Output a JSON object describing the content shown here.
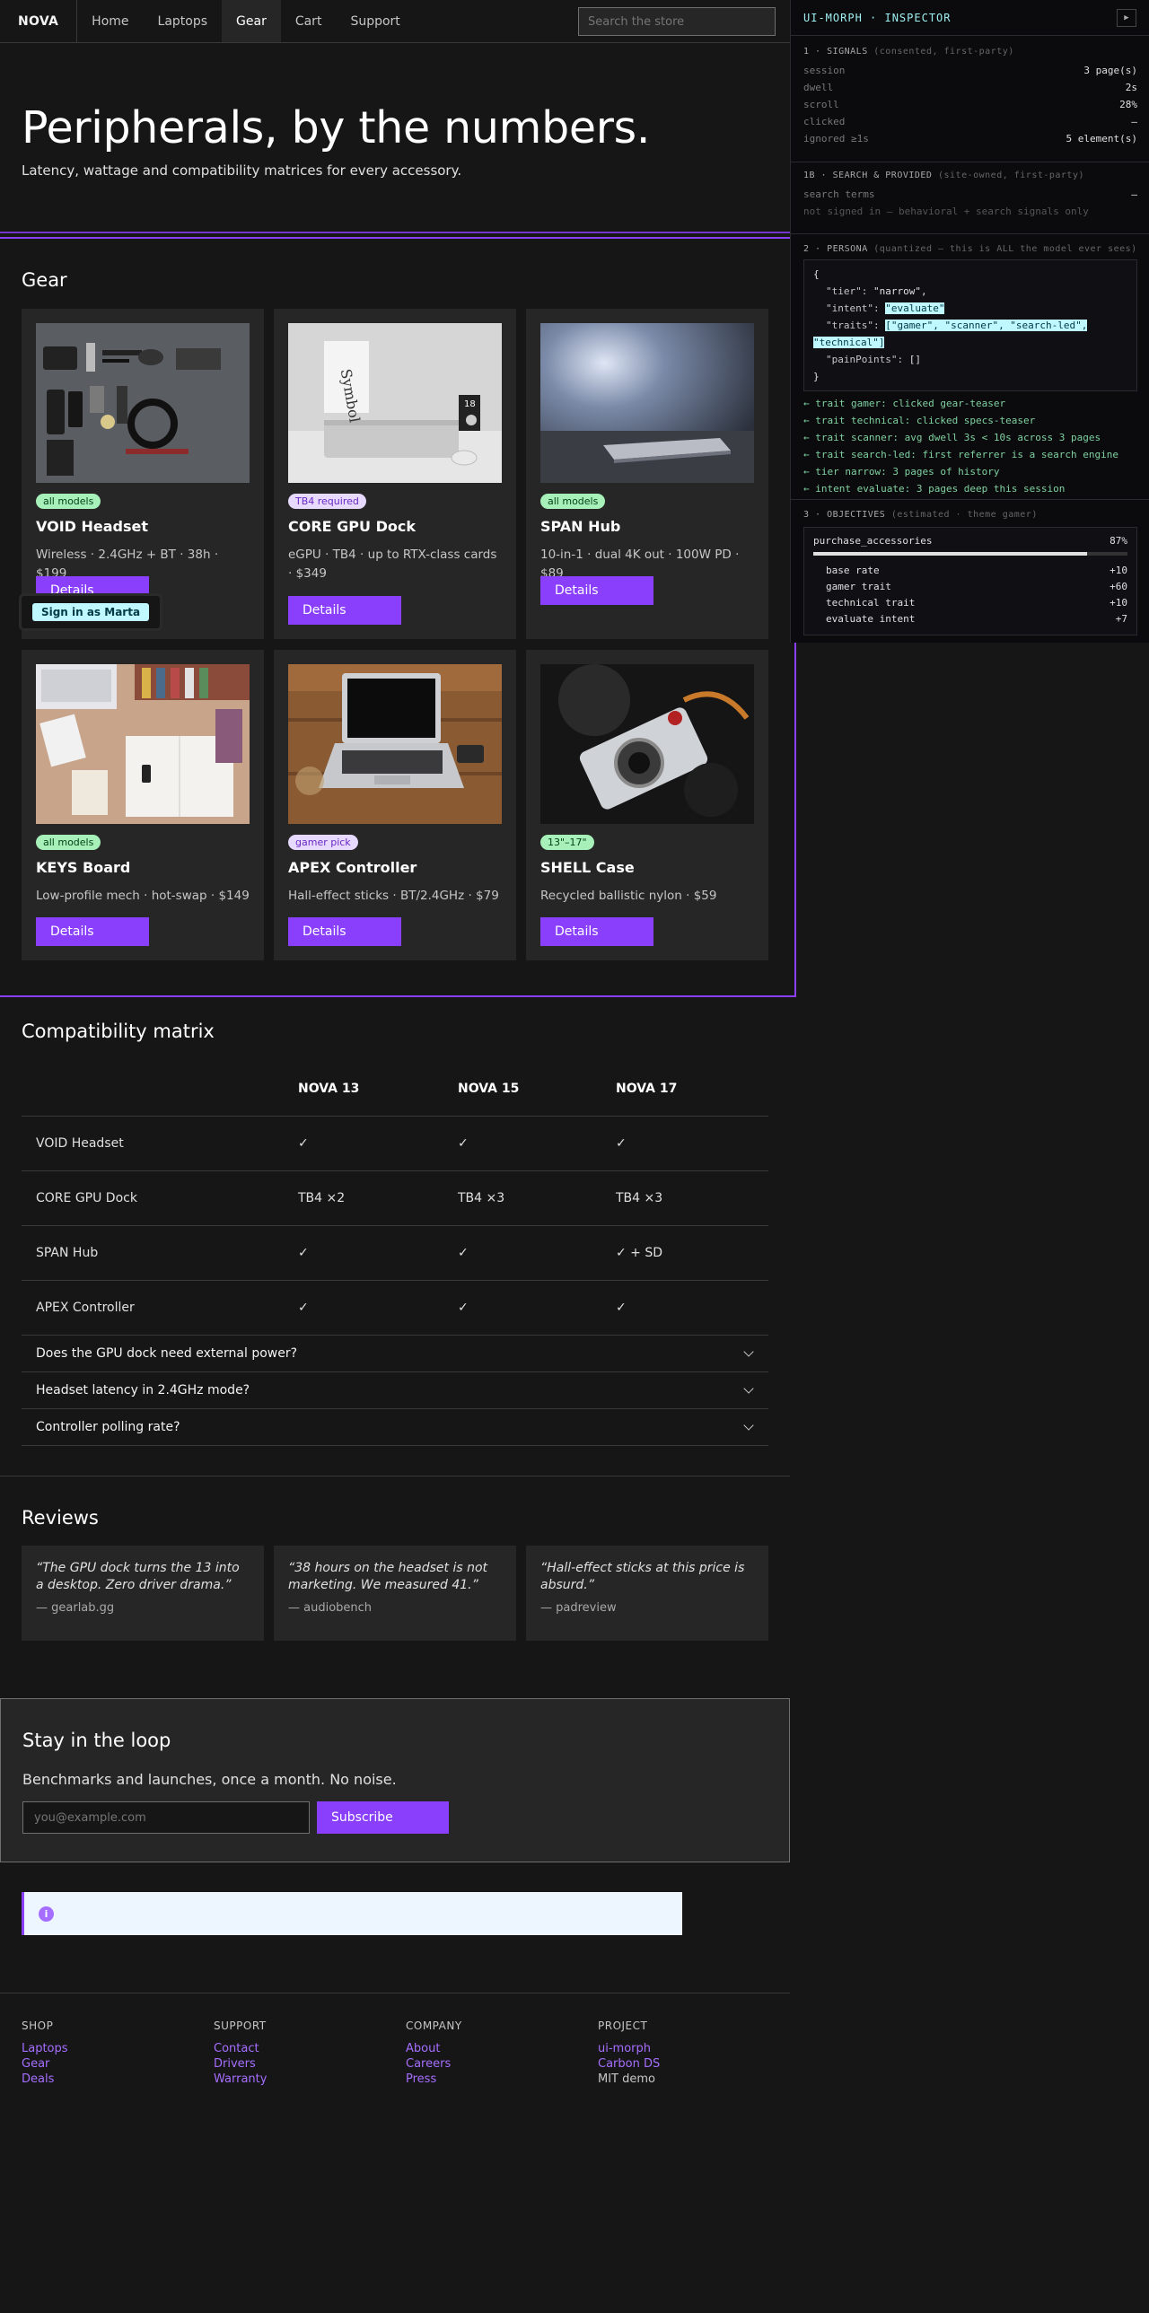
{
  "nav": {
    "brand": "NOVA",
    "links": [
      "Home",
      "Laptops",
      "Gear",
      "Cart",
      "Support"
    ],
    "active": "Gear",
    "search_placeholder": "Search the store"
  },
  "hero": {
    "title": "Peripherals, by the numbers.",
    "subtitle": "Latency, wattage and compatibility matrices for every accessory."
  },
  "gear": {
    "title": "Gear",
    "cards": [
      {
        "tag": "all models",
        "tag_color": "#a7f0ba",
        "name": "VOID Headset",
        "spec": "Wireless · 2.4GHz + BT · 38h · $199",
        "button": "Details",
        "image": "flatlay-accessories"
      },
      {
        "tag": "TB4 required",
        "tag_color": "#e8daff",
        "name": "CORE GPU Dock",
        "spec": "eGPU · TB4 · up to RTX-class cards · $349",
        "button": "Details",
        "image": "laptop-with-book"
      },
      {
        "tag": "all models",
        "tag_color": "#a7f0ba",
        "name": "SPAN Hub",
        "spec": "10-in-1 · dual 4K out · 100W PD · $89",
        "button": "Details",
        "image": "phone-closeup"
      },
      {
        "tag": "all models",
        "tag_color": "#a7f0ba",
        "name": "KEYS Board",
        "spec": "Low-profile mech · hot-swap · $149",
        "button": "Details",
        "image": "desk-workspace"
      },
      {
        "tag": "gamer pick",
        "tag_color": "#e8daff",
        "name": "APEX Controller",
        "spec": "Hall-effect sticks · BT/2.4GHz · $79",
        "button": "Details",
        "image": "laptop-on-wood"
      },
      {
        "tag": "13\"–17\"",
        "tag_color": "#a7f0ba",
        "name": "SHELL Case",
        "spec": "Recycled ballistic nylon · $59",
        "button": "Details",
        "image": "camera-closeup"
      }
    ],
    "signin_overlay": "Sign in as Marta"
  },
  "compat": {
    "title": "Compatibility matrix",
    "columns": [
      "",
      "NOVA 13",
      "NOVA 15",
      "NOVA 17"
    ],
    "rows": [
      [
        "VOID Headset",
        "✓",
        "✓",
        "✓"
      ],
      [
        "CORE GPU Dock",
        "TB4 ×2",
        "TB4 ×3",
        "TB4 ×3"
      ],
      [
        "SPAN Hub",
        "✓",
        "✓",
        "✓ + SD"
      ],
      [
        "APEX Controller",
        "✓",
        "✓",
        "✓"
      ]
    ],
    "faq": [
      "Does the GPU dock need external power?",
      "Headset latency in 2.4GHz mode?",
      "Controller polling rate?"
    ]
  },
  "reviews": {
    "title": "Reviews",
    "items": [
      {
        "quote": "“The GPU dock turns the 13 into a desktop. Zero driver drama.”",
        "author": "— gearlab.gg"
      },
      {
        "quote": "“38 hours on the headset is not marketing. We measured 41.”",
        "author": "— audiobench"
      },
      {
        "quote": "“Hall-effect sticks at this price is absurd.”",
        "author": "— padreview"
      }
    ]
  },
  "newsletter": {
    "title": "Stay in the loop",
    "text": "Benchmarks and launches, once a month. No noise.",
    "placeholder": "you@example.com",
    "button": "Subscribe"
  },
  "footer": {
    "columns": [
      {
        "heading": "SHOP",
        "links": [
          "Laptops",
          "Gear",
          "Deals"
        ]
      },
      {
        "heading": "SUPPORT",
        "links": [
          "Contact",
          "Drivers",
          "Warranty"
        ]
      },
      {
        "heading": "COMPANY",
        "links": [
          "About",
          "Careers",
          "Press"
        ]
      },
      {
        "heading": "PROJECT",
        "links": [
          "ui-morph",
          "Carbon DS",
          "MIT demo"
        ]
      }
    ]
  },
  "inspector": {
    "title": "UI-MORPH · INSPECTOR",
    "signals": {
      "heading": "1 · SIGNALS",
      "note": "(consented, first-party)",
      "rows": [
        {
          "k": "session",
          "v": "3 page(s)"
        },
        {
          "k": "dwell",
          "v": "2s"
        },
        {
          "k": "scroll",
          "v": "28%"
        },
        {
          "k": "clicked",
          "v": "—"
        },
        {
          "k": "ignored ≥1s",
          "v": "5 element(s)"
        }
      ]
    },
    "search": {
      "heading": "1B · SEARCH & PROVIDED",
      "note": "(site-owned, first-party)",
      "terms_label": "search terms",
      "terms_value": "—",
      "footnote": "not signed in — behavioral + search signals only"
    },
    "persona": {
      "heading": "2 · PERSONA",
      "note": "(quantized — this is ALL the model ever sees)",
      "code_open": "{",
      "tier_key": "\"tier\": ",
      "tier_val": "\"narrow\",",
      "intent_key": "\"intent\": ",
      "intent_val": "\"evaluate\"",
      "traits_key": "\"traits\": ",
      "traits_val_a": "[\"gamer\", \"scanner\", \"search-led\",",
      "traits_val_b": "\"technical\"]",
      "pain_key": "\"painPoints\": ",
      "pain_val": "[]",
      "code_close": "}",
      "traits": [
        "← trait gamer: clicked gear-teaser",
        "← trait technical: clicked specs-teaser",
        "← trait scanner: avg dwell 3s < 10s across 3 pages",
        "← trait search-led: first referrer is a search engine",
        "← tier narrow: 3 pages of history",
        "← intent evaluate: 3 pages deep this session"
      ]
    },
    "objectives": {
      "heading": "3 · OBJECTIVES",
      "note": "(estimated · theme gamer)",
      "name": "purchase_accessories",
      "value": "87%",
      "progress": 0.87,
      "items": [
        {
          "k": "base rate",
          "v": "+10"
        },
        {
          "k": "gamer trait",
          "v": "+60"
        },
        {
          "k": "technical trait",
          "v": "+10"
        },
        {
          "k": "evaluate intent",
          "v": "+7"
        }
      ]
    }
  }
}
